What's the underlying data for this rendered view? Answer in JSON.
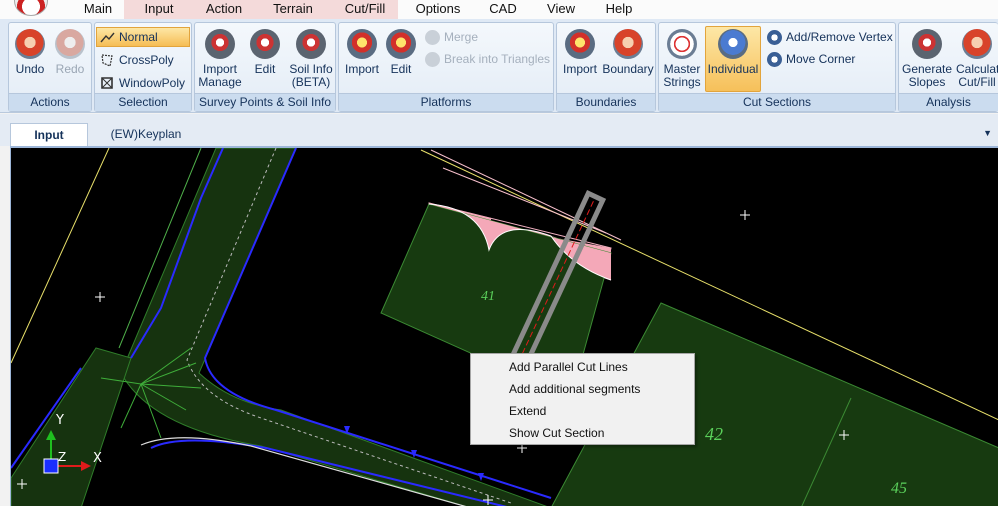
{
  "menu": {
    "items": [
      "Main",
      "Input",
      "Action",
      "Terrain",
      "Cut/Fill",
      "Options",
      "CAD",
      "View",
      "Help"
    ]
  },
  "ribbon": {
    "actions": {
      "label": "Actions",
      "undo": "Undo",
      "redo": "Redo"
    },
    "selection": {
      "label": "Selection",
      "normal": "Normal",
      "crosspoly": "CrossPoly",
      "windowpoly": "WindowPoly"
    },
    "survey": {
      "label": "Survey Points & Soil Info",
      "import_line1": "Import",
      "import_line2": "Manage",
      "edit": "Edit",
      "soil_line1": "Soil Info",
      "soil_line2": "(BETA)"
    },
    "platforms": {
      "label": "Platforms",
      "import": "Import",
      "edit": "Edit",
      "merge": "Merge",
      "break": "Break into Triangles"
    },
    "boundaries": {
      "label": "Boundaries",
      "import": "Import",
      "boundary": "Boundary"
    },
    "cut_sections": {
      "label": "Cut Sections",
      "master_line1": "Master",
      "master_line2": "Strings",
      "individual": "Individual",
      "add_remove_vertex": "Add/Remove Vertex",
      "move_corner": "Move Corner"
    },
    "analysis": {
      "label": "Analysis",
      "generate_line1": "Generate",
      "generate_line2": "Slopes",
      "calc_line1": "Calculate",
      "calc_line2": "Cut/Fill"
    }
  },
  "tabs": {
    "input": "Input",
    "keyplan": "(EW)Keyplan"
  },
  "viewport": {
    "axis_y": "Y",
    "axis_z": "Z",
    "axis_x": "X",
    "lot_42": "42",
    "lot_45": "45",
    "lot_41": "41"
  },
  "context_menu": {
    "items": [
      "Add Parallel Cut Lines",
      "Add additional segments",
      "Extend",
      "Show Cut Section"
    ]
  }
}
